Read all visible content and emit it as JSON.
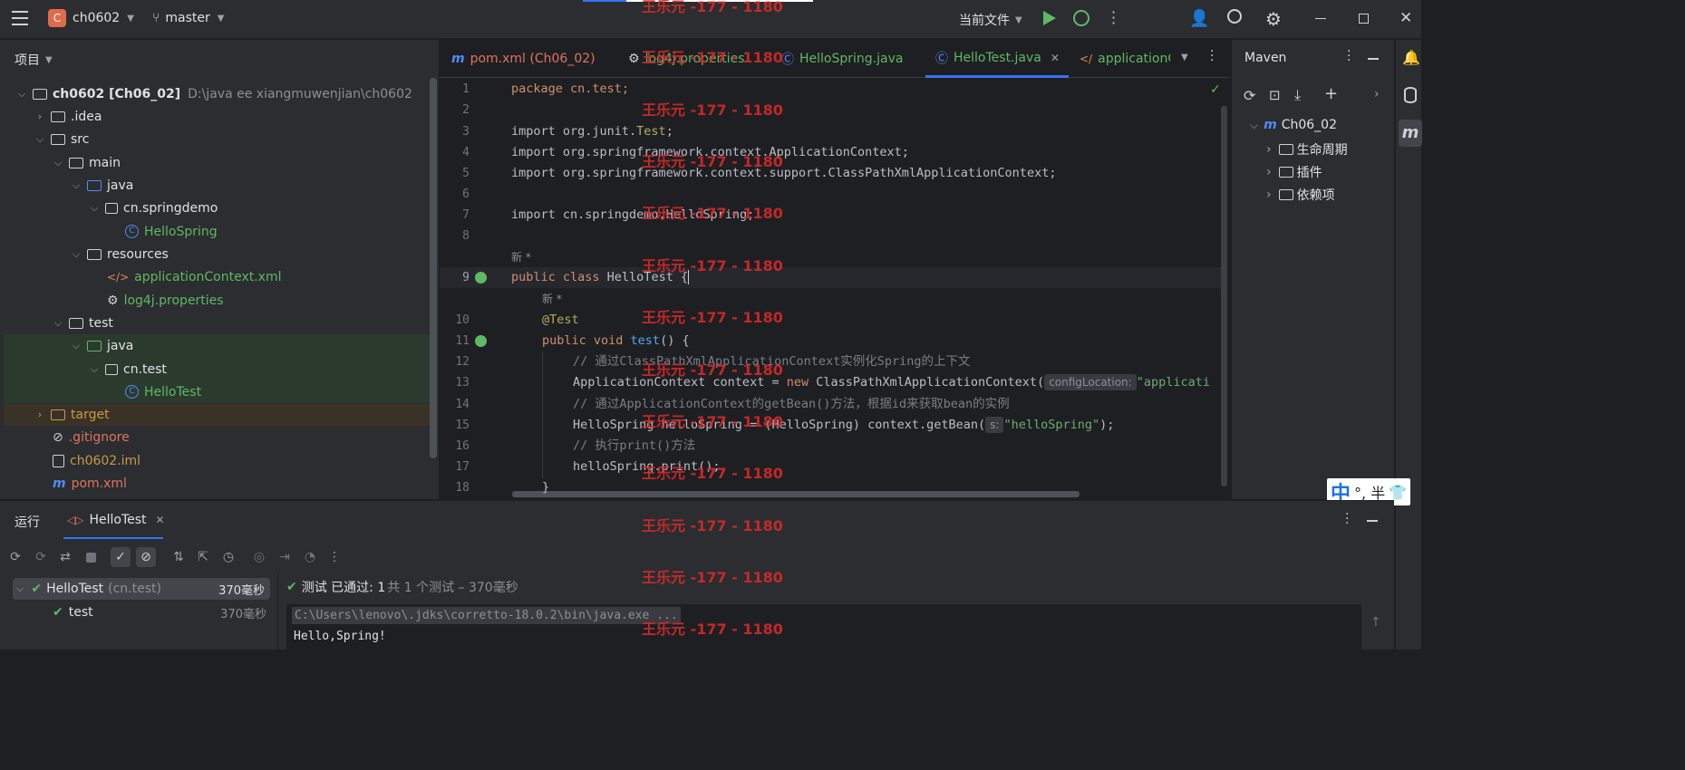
{
  "topbar": {
    "project_letter": "C",
    "project": "ch0602",
    "branch": "master",
    "run_config": "当前文件"
  },
  "project_panel": {
    "title": "项目"
  },
  "tree": {
    "root_name": "ch0602 [Ch06_02]",
    "root_path": "D:\\java ee xiangmuwenjian\\ch0602",
    "idea": ".idea",
    "src": "src",
    "main": "main",
    "java": "java",
    "pkg": "cn.springdemo",
    "hellospring": "HelloSpring",
    "resources": "resources",
    "appctx": "applicationContext.xml",
    "log4j": "log4j.properties",
    "test": "test",
    "test_java": "java",
    "test_pkg": "cn.test",
    "hellotest": "HelloTest",
    "target": "target",
    "gitignore": ".gitignore",
    "iml": "ch0602.iml",
    "pom": "pom.xml"
  },
  "tabs": [
    "pom.xml (Ch06_02)",
    "log4j.properties",
    "HelloSpring.java",
    "HelloTest.java",
    "applicationC"
  ],
  "code": {
    "l1": "package cn.test;",
    "l3a": "import org.junit.",
    "l3b": "Test",
    "l4": "import org.springframework.context.ApplicationContext;",
    "l5": "import org.springframework.context.support.ClassPathXmlApplicationContext;",
    "l7": "import cn.springdemo.HelloSpring;",
    "new_hint": "新 *",
    "l9a": "public class ",
    "l9b": "HelloTest {",
    "l10": "@Test",
    "l11a": "public void ",
    "l11b": "test",
    "l11c": "() {",
    "l12": "// 通过ClassPathXmlApplicationContext实例化Spring的上下文",
    "l13a": "ApplicationContext context = ",
    "l13b": "new ",
    "l13c": "ClassPathXmlApplicationContext(",
    "l13hint": "configLocation:",
    "l13str": "\"applicati",
    "l14": "// 通过ApplicationContext的getBean()方法，根据id来获取bean的实例",
    "l15a": "HelloSpring helloSpring = (HelloSpring) context.getBean(",
    "l15hint": "s:",
    "l15str": "\"helloSpring\"",
    "l15c": ");",
    "l16": "// 执行print()方法",
    "l17": "helloSpring.print();",
    "l18": "}"
  },
  "maven": {
    "title": "Maven",
    "project": "Ch06_02",
    "items": [
      "生命周期",
      "插件",
      "依赖项"
    ]
  },
  "run": {
    "title": "运行",
    "tab": "HelloTest",
    "result_name": "HelloTest",
    "result_pkg": "(cn.test)",
    "result_time": "370毫秒",
    "test_name": "test",
    "test_time": "370毫秒",
    "status": "测试 已通过: 1",
    "status_sub": "共 1 个测试 – 370毫秒",
    "cmd": "C:\\Users\\lenovo\\.jdks\\corretto-18.0.2\\bin\\java.exe ...",
    "output": "Hello,Spring!"
  },
  "ime": "°, 半",
  "ime_main": "中",
  "watermark": "王乐元 -177 - 1180"
}
